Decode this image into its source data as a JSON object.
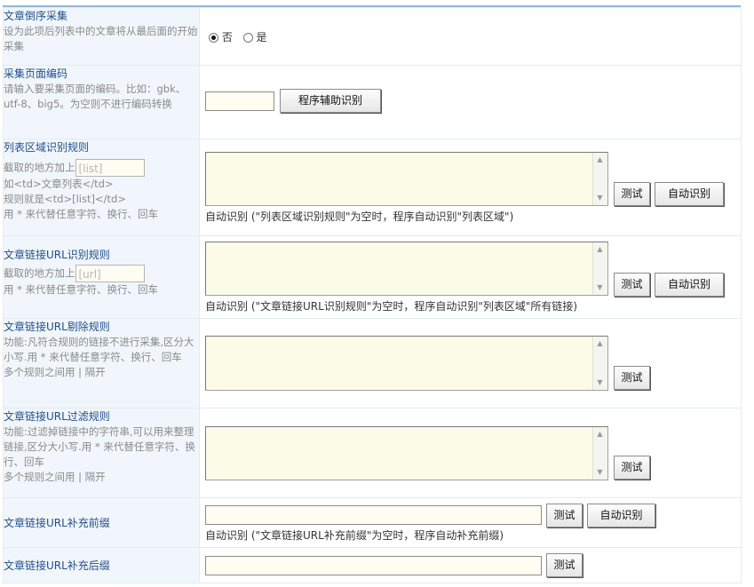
{
  "rows": {
    "reverse": {
      "title": "文章倒序采集",
      "desc": "设为此项后列表中的文章将从最后面的开始采集",
      "options": [
        "否",
        "是"
      ],
      "selected": "否"
    },
    "encoding": {
      "title": "采集页面编码",
      "desc": "请输入要采集页面的编码。比如：gbk、utf-8、big5。为空则不进行编码转换",
      "input_value": "",
      "button": "程序辅助识别"
    },
    "list_area": {
      "title": "列表区域识别规则",
      "desc_prefix": "截取的地方加上",
      "inline_placeholder": "[list]",
      "desc_lines": [
        "如<td>文章列表</td>",
        "规则就是<td>[list]</td>",
        "用 * 来代替任意字符、换行、回车"
      ],
      "buttons": [
        "测试",
        "自动识别"
      ],
      "hint": "自动识别 (\"列表区域识别规则\"为空时，程序自动识别\"列表区域\")"
    },
    "link_url": {
      "title": "文章链接URL识别规则",
      "desc_prefix": "截取的地方加上",
      "inline_placeholder": "[url]",
      "desc_lines": [
        "用 * 来代替任意字符、换行、回车"
      ],
      "buttons": [
        "测试",
        "自动识别"
      ],
      "hint": "自动识别 (\"文章链接URL识别规则\"为空时，程序自动识别\"列表区域\"所有链接)"
    },
    "exclude": {
      "title": "文章链接URL剔除规则",
      "desc": "功能:凡符合规则的链接不进行采集,区分大小写.用 * 来代替任意字符、换行、回车",
      "desc2": "多个规则之间用 | 隔开",
      "button": "测试"
    },
    "filter": {
      "title": "文章链接URL过滤规则",
      "desc": "功能:过滤掉链接中的字符串,可以用来整理链接,区分大小写.用 * 来代替任意字符、换行、回车",
      "desc2": "多个规则之间用 | 隔开",
      "button": "测试"
    },
    "prefix": {
      "title": "文章链接URL补充前缀",
      "input_value": "",
      "buttons": [
        "测试",
        "自动识别"
      ],
      "hint": "自动识别 (\"文章链接URL补充前缀\"为空时，程序自动补充前缀)"
    },
    "suffix": {
      "title": "文章链接URL补充后缀",
      "input_value": "",
      "button": "测试"
    }
  }
}
